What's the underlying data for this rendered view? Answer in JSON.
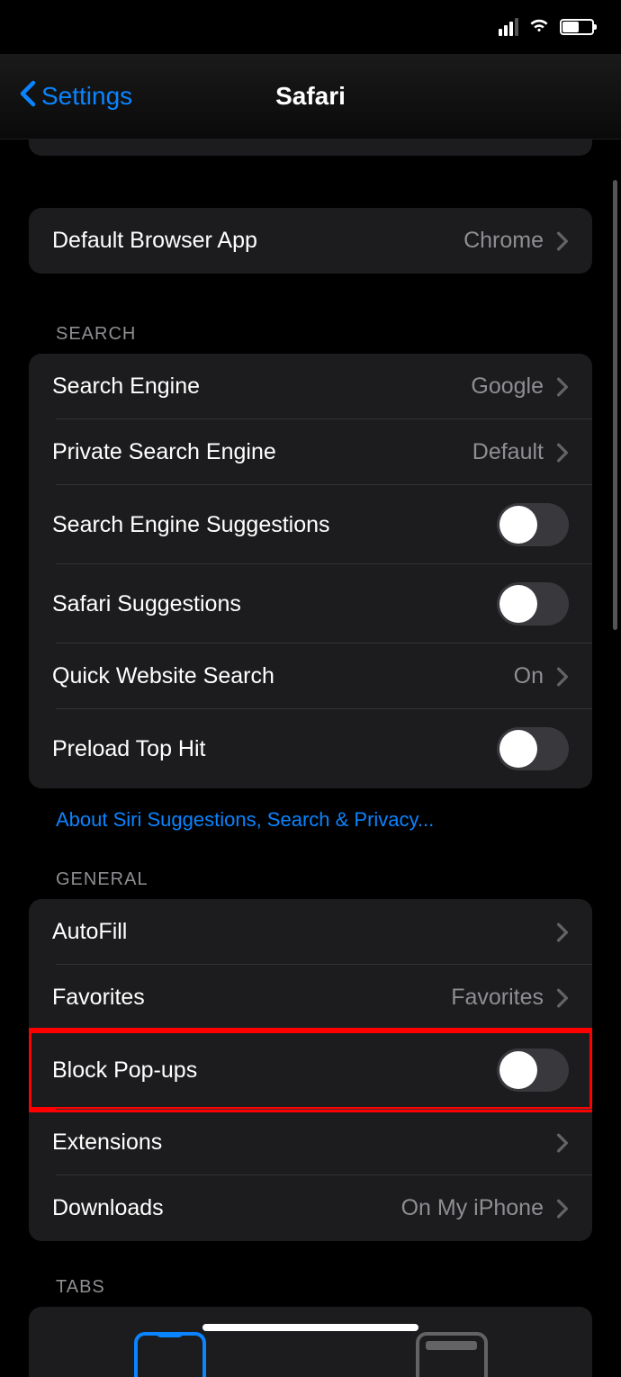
{
  "nav": {
    "back_label": "Settings",
    "title": "Safari"
  },
  "default_browser": {
    "label": "Default Browser App",
    "value": "Chrome"
  },
  "sections": {
    "search": {
      "header": "SEARCH",
      "rows": {
        "search_engine": {
          "label": "Search Engine",
          "value": "Google"
        },
        "private_search_engine": {
          "label": "Private Search Engine",
          "value": "Default"
        },
        "search_engine_suggestions": {
          "label": "Search Engine Suggestions",
          "toggle": false
        },
        "safari_suggestions": {
          "label": "Safari Suggestions",
          "toggle": false
        },
        "quick_website_search": {
          "label": "Quick Website Search",
          "value": "On"
        },
        "preload_top_hit": {
          "label": "Preload Top Hit",
          "toggle": false
        }
      },
      "footer_link": "About Siri Suggestions, Search & Privacy..."
    },
    "general": {
      "header": "GENERAL",
      "rows": {
        "autofill": {
          "label": "AutoFill"
        },
        "favorites": {
          "label": "Favorites",
          "value": "Favorites"
        },
        "block_popups": {
          "label": "Block Pop-ups",
          "toggle": false
        },
        "extensions": {
          "label": "Extensions"
        },
        "downloads": {
          "label": "Downloads",
          "value": "On My iPhone"
        }
      }
    },
    "tabs": {
      "header": "TABS"
    }
  }
}
